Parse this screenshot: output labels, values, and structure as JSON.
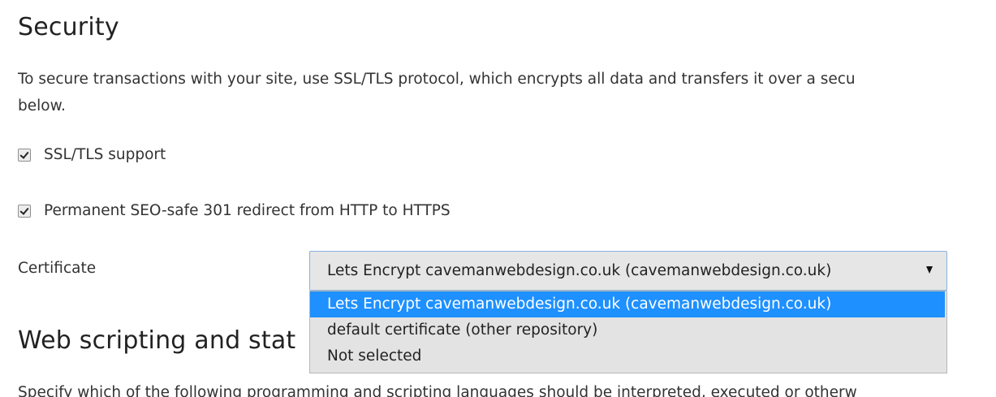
{
  "security": {
    "title": "Security",
    "description_line1": "To secure transactions with your site, use SSL/TLS protocol, which encrypts all data and transfers it over a secu",
    "description_line2": "below.",
    "ssl_support": {
      "label": "SSL/TLS support",
      "checked": true
    },
    "redirect": {
      "label": "Permanent SEO-safe 301 redirect from HTTP to HTTPS",
      "checked": true
    },
    "certificate": {
      "label": "Certificate",
      "selected": "Lets Encrypt cavemanwebdesign.co.uk (cavemanwebdesign.co.uk)",
      "options": [
        "Lets Encrypt cavemanwebdesign.co.uk (cavemanwebdesign.co.uk)",
        "default certificate (other repository)",
        "Not selected"
      ],
      "highlighted_option": 0
    }
  },
  "web_scripting": {
    "title": "Web scripting and stat",
    "description": "Specify which of the following programming and scripting languages should be interpreted, executed or otherw"
  },
  "colors": {
    "highlight": "#1e90ff",
    "select_border": "#8ab1e0"
  }
}
